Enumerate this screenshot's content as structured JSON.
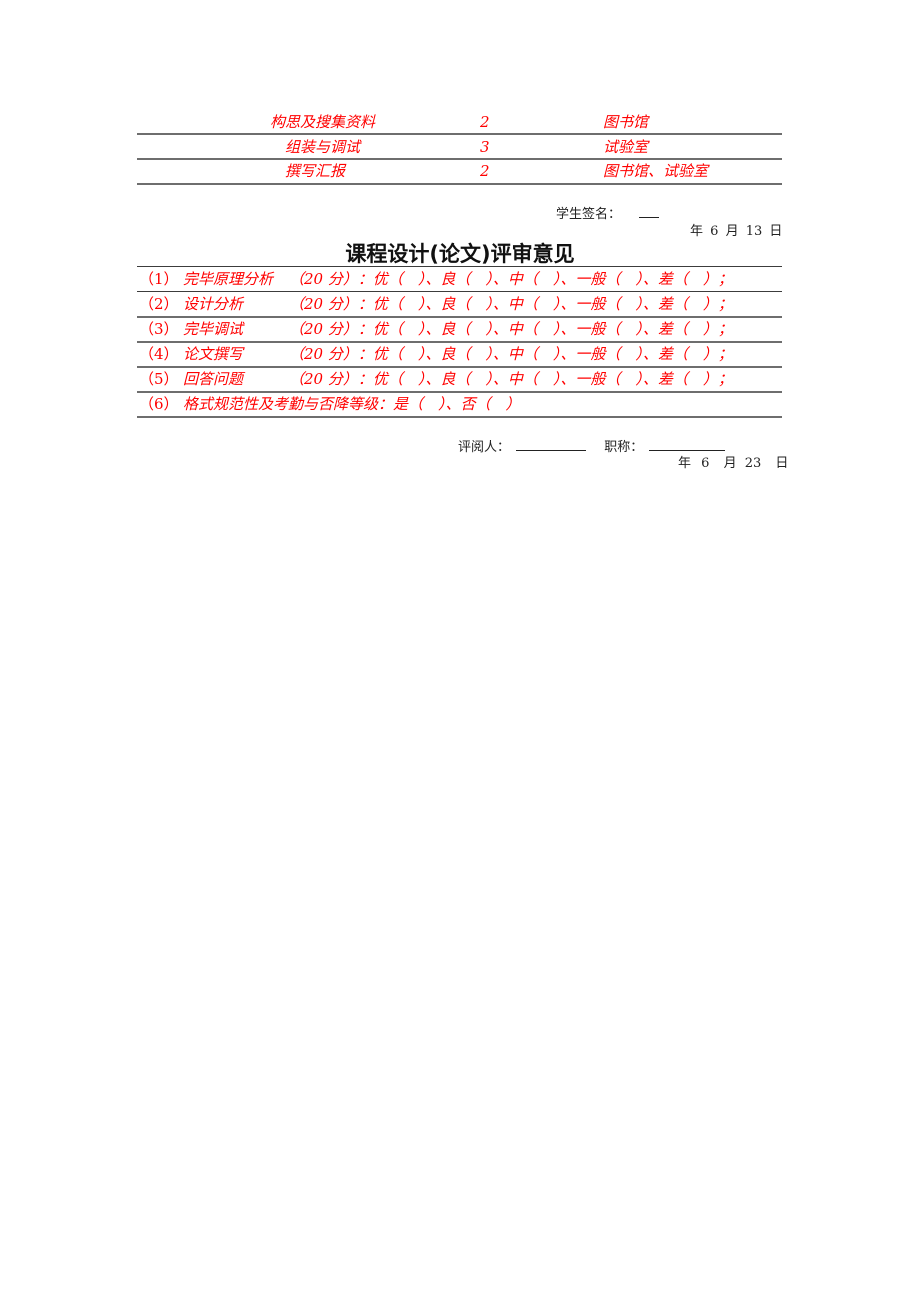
{
  "schedule": {
    "rows": [
      {
        "task": "构思及搜集资料",
        "days": "2",
        "place": "图书馆"
      },
      {
        "task": "组装与调试",
        "days": "3",
        "place": "试验室"
      },
      {
        "task": "撰写汇报",
        "days": "2",
        "place": "图书馆、试验室"
      }
    ]
  },
  "student_sign": {
    "label": "学生签名：",
    "date": {
      "year_label": "年",
      "month": "6",
      "month_label": "月",
      "day": "13",
      "day_label": "日"
    }
  },
  "review": {
    "title": "课程设计(论文)评审意见",
    "items": [
      {
        "index": "（1）",
        "name": "完毕原理分析",
        "score": "（20 分）：",
        "grades": "优（　）、良（　）、中（　）、一般（　）、差（　）；"
      },
      {
        "index": "（2）",
        "name": "设计分析",
        "score": "（20 分）：",
        "grades": "优（　）、良（　）、中（　）、一般（　）、差（　）；"
      },
      {
        "index": "（3）",
        "name": "完毕调试",
        "score": "（20 分）：",
        "grades": "优（　）、良（　）、中（　）、一般（　）、差（　）；"
      },
      {
        "index": "（4）",
        "name": "论文撰写",
        "score": "（20 分）：",
        "grades": "优（　）、良（　）、中（　）、一般（　）、差（　）；"
      },
      {
        "index": "（5）",
        "name": "回答问题",
        "score": "（20 分）：",
        "grades": "优（　）、良（　）、中（　）、一般（　）、差（　）；"
      }
    ],
    "item6": {
      "index": "（6）",
      "text": "格式规范性及考勤与否降等级：是（　）、否（　）"
    }
  },
  "reviewer_sign": {
    "reviewer_label": "评阅人：",
    "title_label": "职称：",
    "date": {
      "year_label": "年",
      "month": "6",
      "month_label": "月",
      "day": "23",
      "day_label": "日"
    }
  },
  "colors": {
    "accent_red": "#ff0000",
    "rule_gray": "#6e6e6e"
  }
}
